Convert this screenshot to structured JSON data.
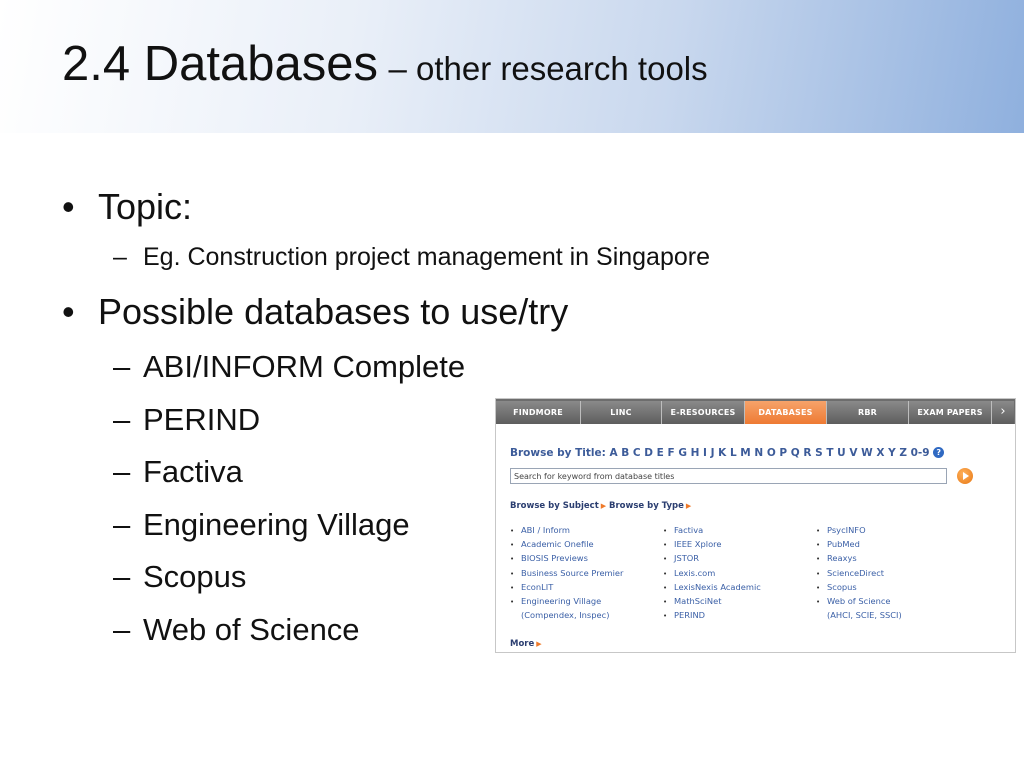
{
  "slide": {
    "title": "2.4 Databases",
    "subtitle": "– other research tools"
  },
  "bullets": [
    {
      "text": "Topic:",
      "subs": [
        "Eg. Construction project management in Singapore"
      ]
    },
    {
      "text": "Possible databases to use/try",
      "subs": [
        "ABI/INFORM Complete",
        "PERIND",
        "Factiva",
        "Engineering Village",
        "Scopus",
        "Web of Science"
      ]
    }
  ],
  "screenshot": {
    "tabs": [
      "FINDMORE",
      "LINC",
      "E-RESOURCES",
      "DATABASES",
      "RBR",
      "EXAM PAPERS"
    ],
    "active_tab": "DATABASES",
    "tab_arrow": "›",
    "browse_by_title": "Browse by Title: A B C D E F G H I J K L M N O P Q R S T U V W X Y Z 0-9",
    "help_icon": "?",
    "search_placeholder": "Search for keyword from database titles",
    "browse_by_subject": "Browse by Subject",
    "browse_by_type": "Browse by Type",
    "columns": [
      [
        "ABI / Inform",
        "Academic Onefile",
        "BIOSIS Previews",
        "Business Source Premier",
        "EconLIT",
        "Engineering Village",
        "(Compendex, Inspec)"
      ],
      [
        "Factiva",
        "IEEE Xplore",
        "JSTOR",
        "Lexis.com",
        "LexisNexis Academic",
        "MathSciNet",
        "PERIND"
      ],
      [
        "PsycINFO",
        "PubMed",
        "Reaxys",
        "ScienceDirect",
        "Scopus",
        "Web of Science",
        "(AHCI, SCIE, SSCI)"
      ]
    ],
    "more": "More",
    "accent_color": "#ee7a33",
    "link_color": "#3a5fa6"
  }
}
